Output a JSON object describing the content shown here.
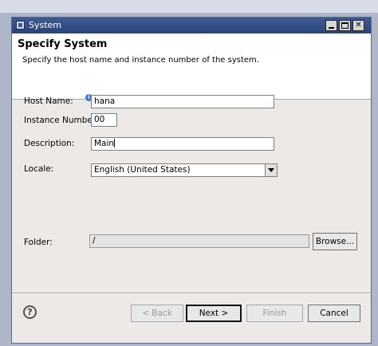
{
  "window": {
    "title": "System",
    "controls": [
      "minimize",
      "maximize",
      "close"
    ]
  },
  "banner": {
    "title": "Specify System",
    "description": "Specify the host name and instance number of the system."
  },
  "form": {
    "host_name": {
      "label": "Host Name:",
      "value": "hana"
    },
    "instance_number": {
      "label": "Instance Number:",
      "value": "00"
    },
    "description": {
      "label": "Description:",
      "value": "Main"
    },
    "locale": {
      "label": "Locale:",
      "value": "English (United States)"
    },
    "folder": {
      "label": "Folder:",
      "value": "/",
      "browse_label": "Browse..."
    }
  },
  "footer": {
    "help_glyph": "?",
    "back_label": "< Back",
    "next_label": "Next >",
    "finish_label": "Finish",
    "cancel_label": "Cancel"
  },
  "icons": {
    "window_icon": "window-icon",
    "info_icon": "info-icon",
    "help_icon": "help-icon",
    "dropdown_icon": "chevron-down-icon"
  }
}
